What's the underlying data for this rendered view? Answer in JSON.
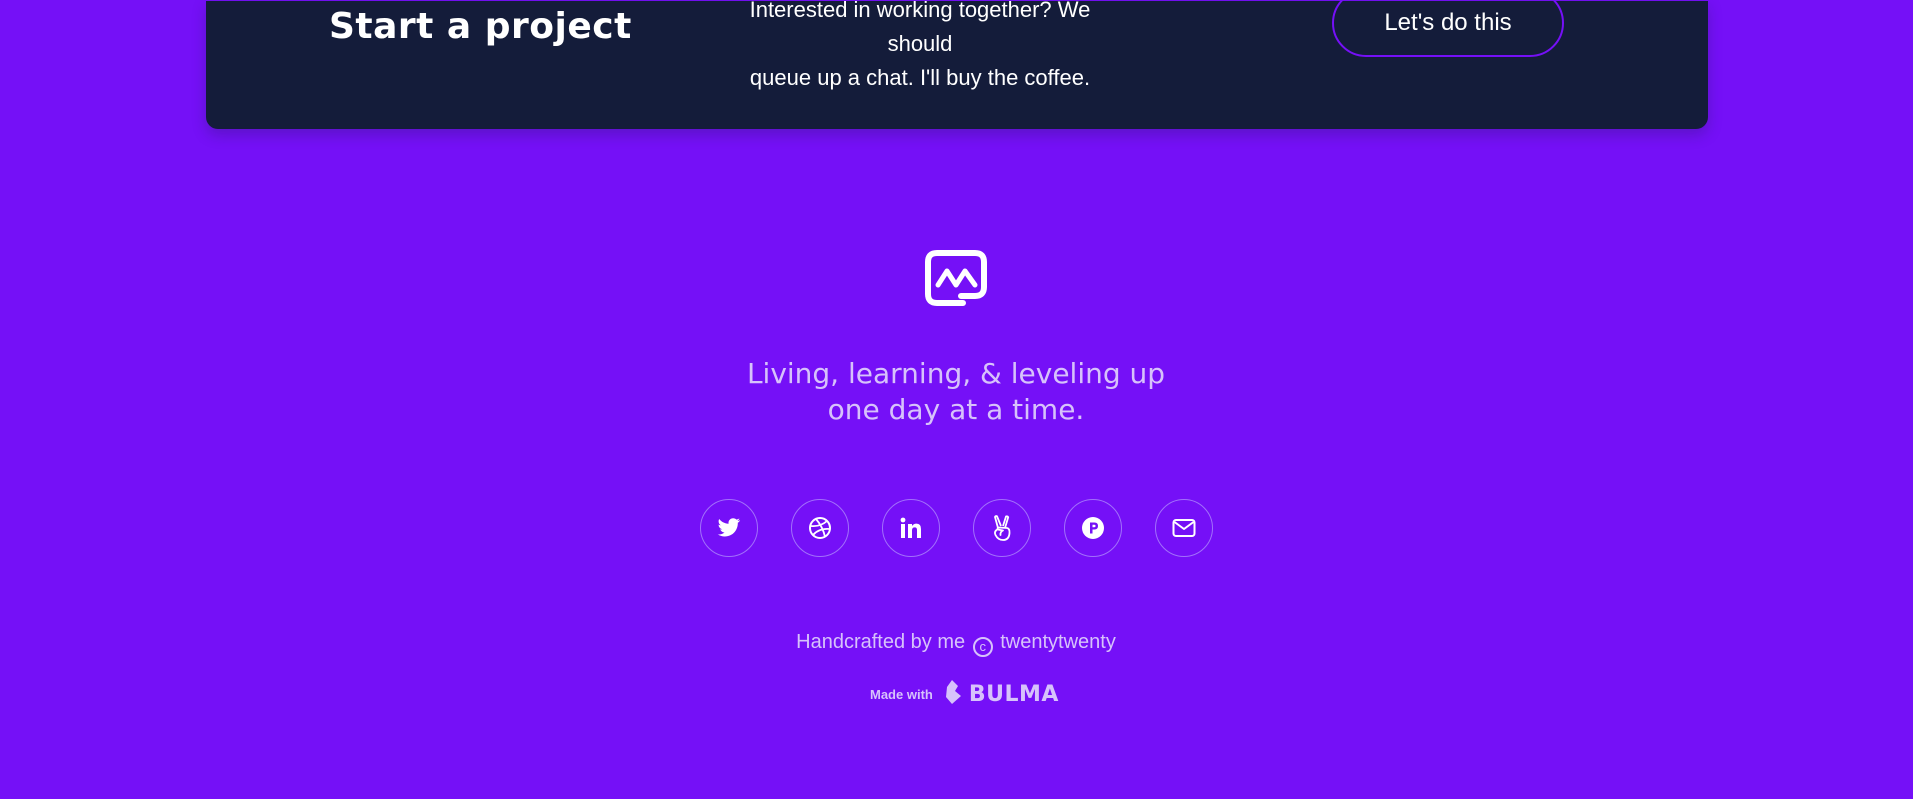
{
  "cta": {
    "title": "Start a project",
    "text_line1": "Interested in working together? We should",
    "text_line2": "queue up a chat. I'll buy the coffee.",
    "button_label": "Let's do this"
  },
  "footer": {
    "logo_icon": "logo-icon",
    "tagline_line1": "Living, learning, & leveling up",
    "tagline_line2": "one day at a time.",
    "social": [
      {
        "name": "twitter",
        "icon": "twitter-icon"
      },
      {
        "name": "dribbble",
        "icon": "dribbble-icon"
      },
      {
        "name": "linkedin",
        "icon": "linkedin-icon"
      },
      {
        "name": "angellist",
        "icon": "angellist-icon"
      },
      {
        "name": "producthunt",
        "icon": "producthunt-icon"
      },
      {
        "name": "email",
        "icon": "envelope-icon"
      }
    ],
    "credit_prefix": "Handcrafted by me",
    "credit_symbol": "c",
    "credit_suffix": "twentytwenty",
    "made_with_label": "Made with",
    "bulma_label": "BULMA"
  },
  "colors": {
    "accent": "#7510f7",
    "dark": "#141c3a",
    "muted_text": "#d7c2fb",
    "social_border": "#a270fb"
  }
}
